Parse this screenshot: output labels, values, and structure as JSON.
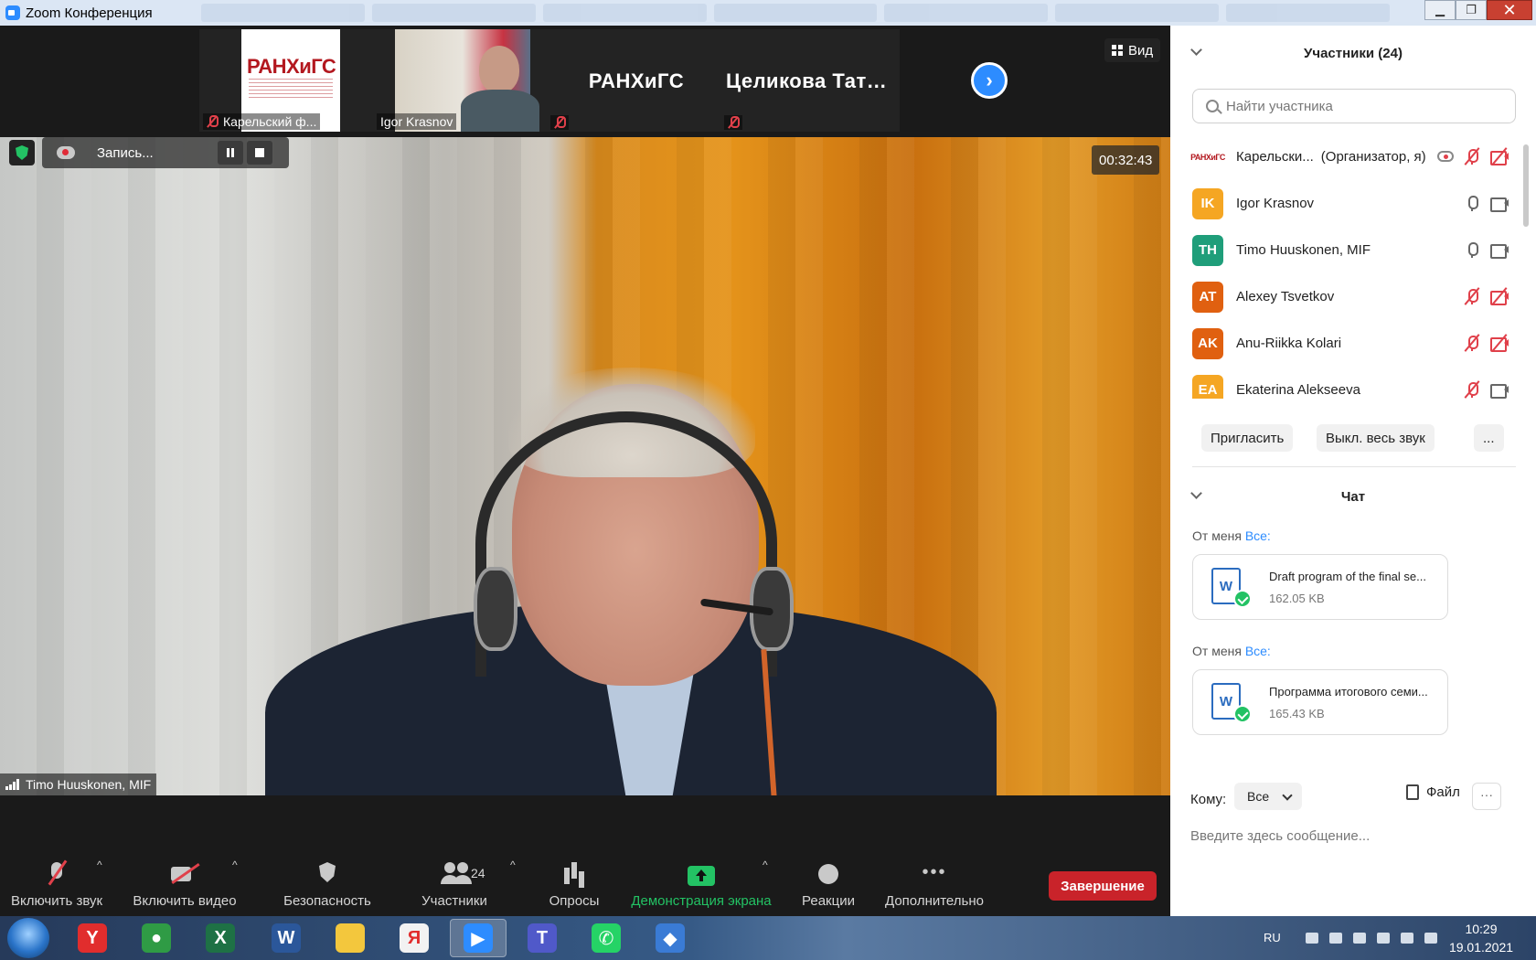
{
  "window": {
    "title": "Zoom Конференция",
    "controls": {
      "minimize": "▁",
      "maximize": "❐",
      "close": "✕"
    }
  },
  "thumbnails": [
    {
      "name": "Карельский ф...",
      "type": "logo",
      "logo_text": "РАНХиГС",
      "muted": true
    },
    {
      "name": "Igor Krasnov",
      "type": "video",
      "muted": false
    },
    {
      "name": "РАНХиГС",
      "type": "name-only",
      "muted": true
    },
    {
      "name": "Целикова  Тать...",
      "type": "name-only",
      "muted": true
    }
  ],
  "view_button": {
    "label": "Вид",
    "icon": "grid-icon"
  },
  "recording": {
    "label": "Запись..."
  },
  "timer": "00:32:43",
  "active_speaker": {
    "name": "Timo Huuskonen, MIF"
  },
  "toolbar": {
    "items": [
      {
        "label": "Включить звук",
        "icon": "mic-off-icon",
        "caret": "^"
      },
      {
        "label": "Включить видео",
        "icon": "video-off-icon",
        "caret": "^"
      },
      {
        "label": "Безопасность",
        "icon": "shield-icon"
      },
      {
        "label": "Участники",
        "icon": "participants-icon",
        "count": "24",
        "caret": "^"
      },
      {
        "label": "Опросы",
        "icon": "polls-icon"
      },
      {
        "label": "Демонстрация экрана",
        "icon": "share-screen-icon",
        "caret": "^"
      },
      {
        "label": "Реакции",
        "icon": "reactions-icon"
      },
      {
        "label": "Дополнительно",
        "icon": "more-icon"
      }
    ],
    "end_label": "Завершение"
  },
  "participants_panel": {
    "title": "Участники (24)",
    "search_placeholder": "Найти участника",
    "list": [
      {
        "initials": "РАНХиГС",
        "name": "Карельски...",
        "role": "(Организатор, я)",
        "color": "#ffffff",
        "mic": "off",
        "video": "off",
        "recording": true
      },
      {
        "initials": "IK",
        "name": "Igor Krasnov",
        "role": "",
        "color": "#f5a623",
        "mic": "on",
        "video": "on"
      },
      {
        "initials": "TH",
        "name": "Timo Huuskonen, MIF",
        "role": "",
        "color": "#1f9e7a",
        "mic": "on",
        "video": "on"
      },
      {
        "initials": "AT",
        "name": "Alexey Tsvetkov",
        "role": "",
        "color": "#e06010",
        "mic": "off",
        "video": "off"
      },
      {
        "initials": "AK",
        "name": "Anu-Riikka Kolari",
        "role": "",
        "color": "#e06010",
        "mic": "off",
        "video": "off"
      },
      {
        "initials": "EA",
        "name": "Ekaterina Alekseeva",
        "role": "",
        "color": "#f5a623",
        "mic": "off",
        "video": "on"
      }
    ],
    "buttons": {
      "invite": "Пригласить",
      "mute_all": "Выкл. весь звук",
      "more": "..."
    }
  },
  "chat_panel": {
    "title": "Чат",
    "messages": [
      {
        "from": "От меня",
        "to": "Все:",
        "file_name": "Draft program of the final se...",
        "file_size": "162.05 KB",
        "file_type": "W"
      },
      {
        "from": "От меня",
        "to": "Все:",
        "file_name": "Программа итогового семи...",
        "file_size": "165.43 KB",
        "file_type": "W"
      }
    ],
    "to_label": "Кому:",
    "to_value": "Все",
    "file_label": "Файл",
    "more_label": "···",
    "input_placeholder": "Введите здесь сообщение..."
  },
  "taskbar": {
    "apps": [
      {
        "name": "yandex-browser-icon",
        "glyph": "Y",
        "color": "#e12d2d"
      },
      {
        "name": "chrome-icon",
        "glyph": "●",
        "color": "#2f9b45"
      },
      {
        "name": "excel-icon",
        "glyph": "X",
        "color": "#1e7145"
      },
      {
        "name": "word-icon",
        "glyph": "W",
        "color": "#2b579a"
      },
      {
        "name": "folder-icon",
        "glyph": "",
        "color": "#f3c73d"
      },
      {
        "name": "yandex-icon",
        "glyph": "Я",
        "color": "#f2f2f2"
      },
      {
        "name": "zoom-icon",
        "glyph": "▶",
        "color": "#2d8cff"
      },
      {
        "name": "teams-icon",
        "glyph": "T",
        "color": "#5059c9"
      },
      {
        "name": "whatsapp-icon",
        "glyph": "✆",
        "color": "#25d366"
      },
      {
        "name": "skype-like-icon",
        "glyph": "◆",
        "color": "#3a7bd5"
      }
    ],
    "language": "RU",
    "time": "10:29",
    "date": "19.01.2021"
  }
}
